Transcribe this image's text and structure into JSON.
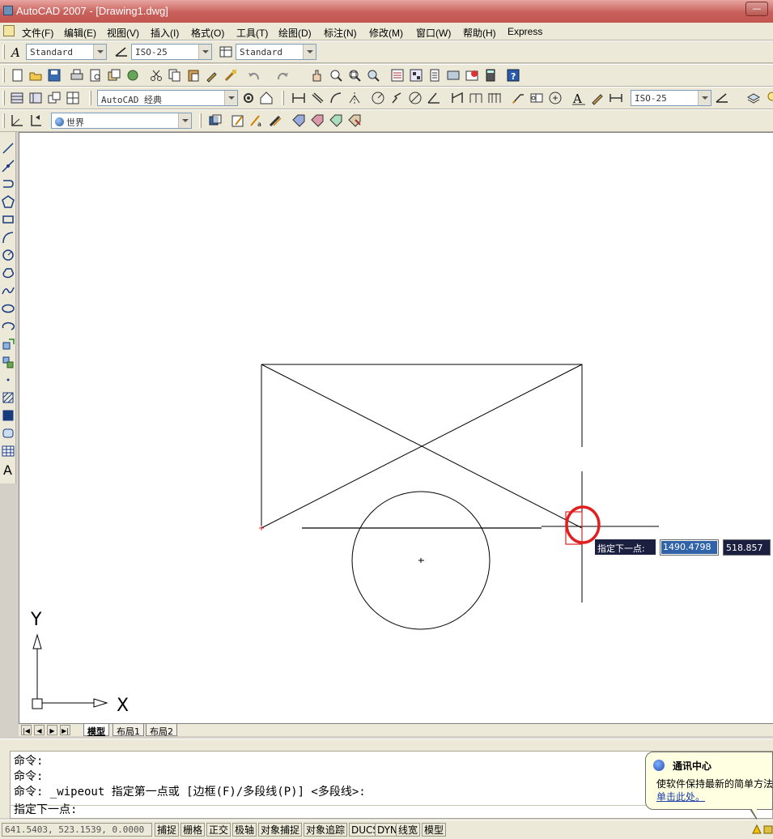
{
  "window": {
    "title": "AutoCAD 2007 - [Drawing1.dwg]"
  },
  "menu": [
    "文件(F)",
    "编辑(E)",
    "视图(V)",
    "插入(I)",
    "格式(O)",
    "工具(T)",
    "绘图(D)",
    "标注(N)",
    "修改(M)",
    "窗口(W)",
    "帮助(H)",
    "Express"
  ],
  "styles_toolbar": {
    "text_style": "Standard",
    "dim_style": "ISO-25",
    "table_style": "Standard"
  },
  "workspace_toolbar": {
    "workspace": "AutoCAD 经典",
    "dim_style": "ISO-25"
  },
  "ucs_toolbar": {
    "ucs": "世界"
  },
  "canvas": {
    "ucs_x_label": "X",
    "ucs_y_label": "Y",
    "dyn_input": {
      "prompt": "指定下一点:",
      "x_value": "1490.4798",
      "y_value": "518.857"
    }
  },
  "layout_tabs": [
    "模型",
    "布局1",
    "布局2"
  ],
  "command": {
    "history": [
      "命令:",
      "命令:",
      "命令: _wipeout 指定第一点或 [边框(F)/多段线(P)] <多段线>:"
    ],
    "current": "指定下一点:"
  },
  "balloon": {
    "title": "通讯中心",
    "text": "使软件保持最新的简单方法",
    "link": "单击此处。"
  },
  "status": {
    "coordinates": "641.5403,  523.1539, 0.0000",
    "toggles": [
      "捕捉",
      "栅格",
      "正交",
      "极轴",
      "对象捕捉",
      "对象追踪",
      "DUCS",
      "DYN",
      "线宽",
      "模型"
    ]
  },
  "colors": {
    "selection_marker": "#e02020",
    "titlebar": "#c9605b",
    "dyn_background": "#1c2040"
  }
}
